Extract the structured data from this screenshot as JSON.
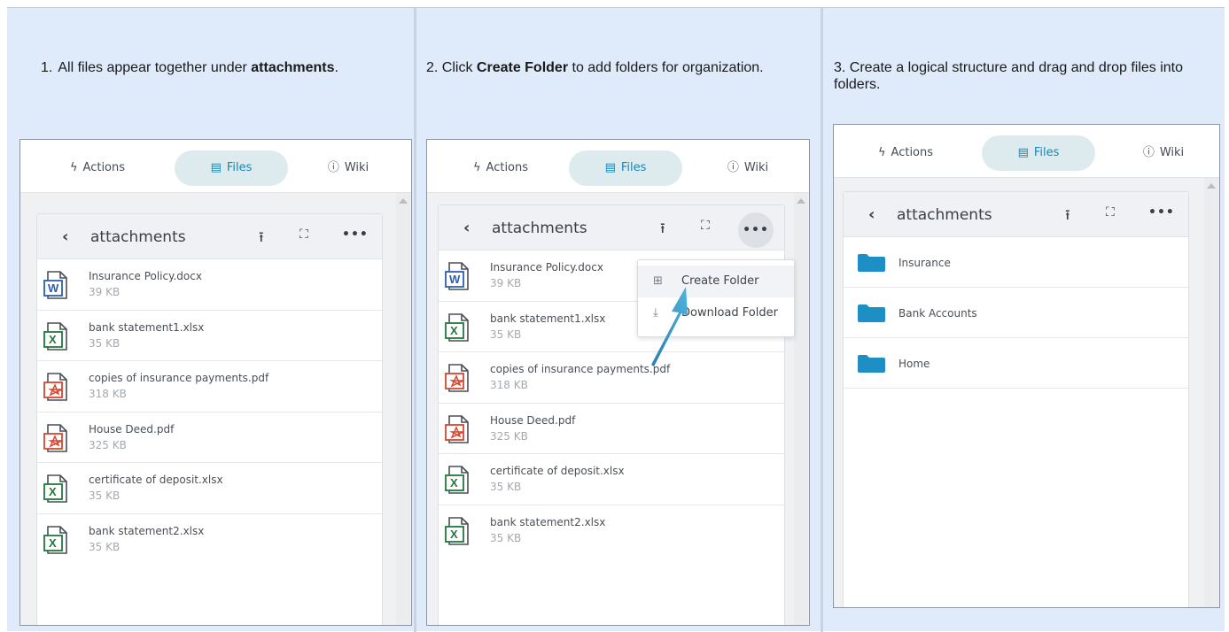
{
  "steps": [
    {
      "number": "1.",
      "text_before": "All files appear together under ",
      "bold": "attachments",
      "text_after": "."
    },
    {
      "number": "2.",
      "text_before": "Click ",
      "bold": "Create Folder",
      "text_after": " to add folders for organization."
    },
    {
      "number": "3.",
      "text": "Create a logical structure and drag and drop files into folders."
    }
  ],
  "tabs": {
    "actions": "Actions",
    "files": "Files",
    "wiki": "Wiki"
  },
  "folder_title": "attachments",
  "files": [
    {
      "name": "Insurance Policy.docx",
      "size": "39 KB",
      "type": "docx"
    },
    {
      "name": "bank statement1.xlsx",
      "size": "35 KB",
      "type": "xlsx"
    },
    {
      "name": "copies of insurance payments.pdf",
      "size": "318 KB",
      "type": "pdf"
    },
    {
      "name": "House Deed.pdf",
      "size": "325 KB",
      "type": "pdf"
    },
    {
      "name": "certificate of deposit.xlsx",
      "size": "35 KB",
      "type": "xlsx"
    },
    {
      "name": "bank statement2.xlsx",
      "size": "35 KB",
      "type": "xlsx"
    }
  ],
  "menu": {
    "create_folder": "Create Folder",
    "download_folder": "Download Folder"
  },
  "folders": [
    "Insurance",
    "Bank Accounts",
    "Home"
  ],
  "colors": {
    "accent": "#1686b8",
    "folder": "#1e8fc4",
    "word": "#2b5fb5",
    "excel": "#1f7a3a",
    "pdf": "#d6452f",
    "background": "#dfeafb"
  },
  "icons": {
    "actions": "lightning-icon",
    "files": "document-icon",
    "wiki": "info-circle-icon",
    "back": "chevron-left-icon",
    "upload": "upload-icon",
    "expand": "expand-icon",
    "more": "ellipsis-icon"
  }
}
